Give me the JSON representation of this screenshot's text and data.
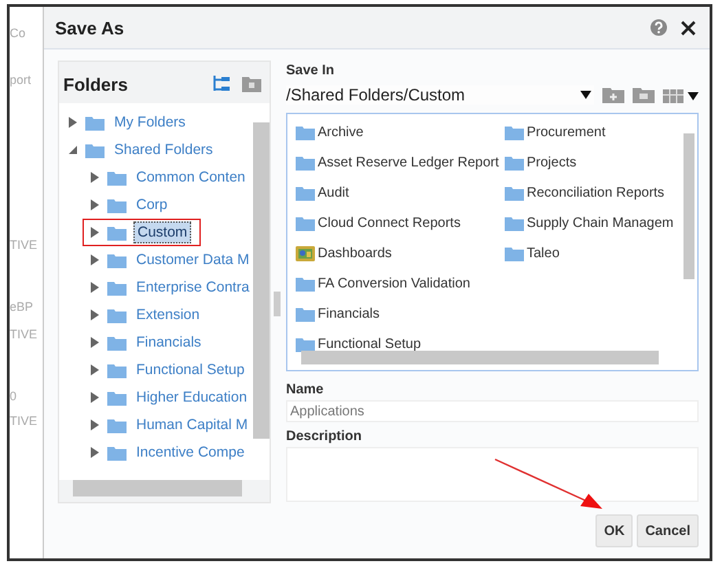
{
  "background_fragments": [
    "Co",
    "port",
    "TIVE",
    "eBP",
    "TIVE",
    "0",
    "TIVE"
  ],
  "dialog": {
    "title": "Save As",
    "folders_panel": {
      "title": "Folders",
      "tree": [
        {
          "label": "My Folders",
          "expanded": false,
          "selected": false,
          "highlighted": false
        },
        {
          "label": "Shared Folders",
          "expanded": true,
          "selected": false,
          "highlighted": false,
          "children": [
            {
              "label": "Common Conten",
              "expanded": false,
              "selected": false,
              "highlighted": false
            },
            {
              "label": "Corp",
              "expanded": false,
              "selected": false,
              "highlighted": false
            },
            {
              "label": "Custom",
              "expanded": false,
              "selected": true,
              "highlighted": true
            },
            {
              "label": "Customer Data M",
              "expanded": false,
              "selected": false,
              "highlighted": false
            },
            {
              "label": "Enterprise Contra",
              "expanded": false,
              "selected": false,
              "highlighted": false
            },
            {
              "label": "Extension",
              "expanded": false,
              "selected": false,
              "highlighted": false
            },
            {
              "label": "Financials",
              "expanded": false,
              "selected": false,
              "highlighted": false
            },
            {
              "label": "Functional Setup",
              "expanded": false,
              "selected": false,
              "highlighted": false
            },
            {
              "label": "Higher Education",
              "expanded": false,
              "selected": false,
              "highlighted": false
            },
            {
              "label": "Human Capital M",
              "expanded": false,
              "selected": false,
              "highlighted": false
            },
            {
              "label": "Incentive Compe",
              "expanded": false,
              "selected": false,
              "highlighted": false
            }
          ]
        }
      ]
    },
    "save_in": {
      "label": "Save In",
      "value": "/Shared Folders/Custom"
    },
    "items": [
      {
        "label": "Archive",
        "kind": "folder"
      },
      {
        "label": "Asset Reserve Ledger Report",
        "kind": "folder"
      },
      {
        "label": "Audit",
        "kind": "folder"
      },
      {
        "label": "Cloud Connect Reports",
        "kind": "folder"
      },
      {
        "label": "Dashboards",
        "kind": "dashboard"
      },
      {
        "label": "FA Conversion Validation",
        "kind": "folder"
      },
      {
        "label": "Financials",
        "kind": "folder"
      },
      {
        "label": "Functional Setup",
        "kind": "folder"
      },
      {
        "label": "Procurement",
        "kind": "folder"
      },
      {
        "label": "Projects",
        "kind": "folder"
      },
      {
        "label": "Reconciliation Reports",
        "kind": "folder"
      },
      {
        "label": "Supply Chain Managem",
        "kind": "folder"
      },
      {
        "label": "Taleo",
        "kind": "folder"
      }
    ],
    "name": {
      "label": "Name",
      "value": "Applications"
    },
    "description": {
      "label": "Description"
    },
    "buttons": [
      "OK",
      "Cancel"
    ]
  }
}
